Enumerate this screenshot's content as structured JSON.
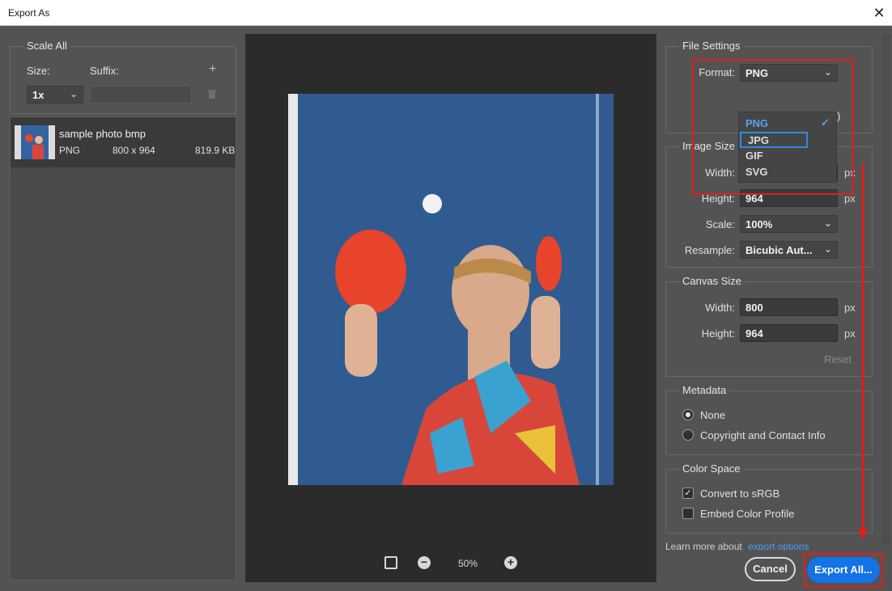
{
  "window": {
    "title": "Export As",
    "close_glyph": "✕"
  },
  "scale_all": {
    "title": "Scale All",
    "size_label": "Size:",
    "suffix_label": "Suffix:",
    "add_glyph": "+",
    "size_value": "1x",
    "suffix_value": "",
    "delete_icon": "trash-icon"
  },
  "asset": {
    "name": "sample photo bmp",
    "format": "PNG",
    "dimensions": "800 x 964",
    "filesize": "819.9 KB"
  },
  "preview": {
    "zoom": "50%"
  },
  "file_settings": {
    "title": "File Settings",
    "format_label": "Format:",
    "format_value": "PNG",
    "partial_text": ")",
    "options": [
      "PNG",
      "JPG",
      "GIF",
      "SVG"
    ],
    "selected_option": "PNG",
    "hover_option": "JPG"
  },
  "image_size": {
    "title": "Image Size",
    "width_label": "Width:",
    "width_value": "800",
    "height_label": "Height:",
    "height_value": "964",
    "scale_label": "Scale:",
    "scale_value": "100%",
    "resample_label": "Resample:",
    "resample_value": "Bicubic Aut...",
    "unit": "px"
  },
  "canvas_size": {
    "title": "Canvas Size",
    "width_label": "Width:",
    "width_value": "800",
    "height_label": "Height:",
    "height_value": "964",
    "unit": "px",
    "reset_label": "Reset"
  },
  "metadata": {
    "title": "Metadata",
    "options": [
      "None",
      "Copyright and Contact Info"
    ],
    "selected": "None"
  },
  "color_space": {
    "title": "Color Space",
    "convert_label": "Convert to sRGB",
    "convert_checked": true,
    "embed_label": "Embed Color Profile",
    "embed_checked": false
  },
  "footer": {
    "learn_more_text": "Learn more about",
    "learn_more_link": "export options",
    "cancel_label": "Cancel",
    "export_label": "Export All..."
  },
  "colors": {
    "accent": "#1473e6",
    "annotation": "#e21d1d",
    "panel": "#535353"
  }
}
